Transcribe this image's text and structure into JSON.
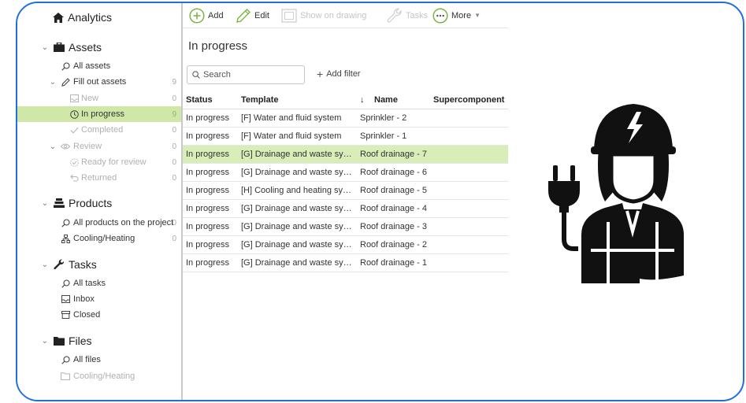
{
  "sidebar": {
    "analytics": {
      "label": "Analytics"
    },
    "assets": {
      "label": "Assets",
      "all": "All assets",
      "fill_out": {
        "label": "Fill out assets",
        "count": "9"
      },
      "new": {
        "label": "New",
        "count": "0"
      },
      "in_progress": {
        "label": "In progress",
        "count": "9"
      },
      "completed": {
        "label": "Completed",
        "count": "0"
      },
      "review": {
        "label": "Review",
        "count": "0"
      },
      "ready": {
        "label": "Ready for review",
        "count": "0"
      },
      "returned": {
        "label": "Returned",
        "count": "0"
      }
    },
    "products": {
      "label": "Products",
      "all": {
        "label": "All products on the project",
        "count": "0"
      },
      "cooling": {
        "label": "Cooling/Heating",
        "count": "0"
      }
    },
    "tasks": {
      "label": "Tasks",
      "all": "All tasks",
      "inbox": "Inbox",
      "closed": "Closed"
    },
    "files": {
      "label": "Files",
      "all": "All files",
      "cooling": "Cooling/Heating"
    }
  },
  "toolbar": {
    "add": "Add",
    "edit": "Edit",
    "show_on_drawing": "Show on drawing",
    "tasks": "Tasks",
    "more": "More"
  },
  "main": {
    "title": "In progress",
    "search_placeholder": "Search",
    "add_filter": "Add filter",
    "columns": {
      "status": "Status",
      "template": "Template",
      "name": "Name",
      "supercomponent": "Supercomponent"
    },
    "rows": [
      {
        "status": "In progress",
        "template": "[F] Water and fluid system",
        "name": "Sprinkler - 2",
        "supercomponent": ""
      },
      {
        "status": "In progress",
        "template": "[F] Water and fluid system",
        "name": "Sprinkler - 1",
        "supercomponent": ""
      },
      {
        "status": "In progress",
        "template": "[G] Drainage and waste syste...",
        "name": "Roof drainage - 7",
        "supercomponent": ""
      },
      {
        "status": "In progress",
        "template": "[G] Drainage and waste syste...",
        "name": "Roof drainage - 6",
        "supercomponent": ""
      },
      {
        "status": "In progress",
        "template": "[H] Cooling and heating syst...",
        "name": "Roof drainage - 5",
        "supercomponent": ""
      },
      {
        "status": "In progress",
        "template": "[G] Drainage and waste syste...",
        "name": "Roof drainage - 4",
        "supercomponent": ""
      },
      {
        "status": "In progress",
        "template": "[G] Drainage and waste syste...",
        "name": "Roof drainage - 3",
        "supercomponent": ""
      },
      {
        "status": "In progress",
        "template": "[G] Drainage and waste syste...",
        "name": "Roof drainage - 2",
        "supercomponent": ""
      },
      {
        "status": "In progress",
        "template": "[G] Drainage and waste syste...",
        "name": "Roof drainage - 1",
        "supercomponent": ""
      }
    ]
  },
  "colors": {
    "accent_green": "#7cb342",
    "selected_bg": "#d8edb8",
    "frame_blue": "#1e6fe0"
  }
}
